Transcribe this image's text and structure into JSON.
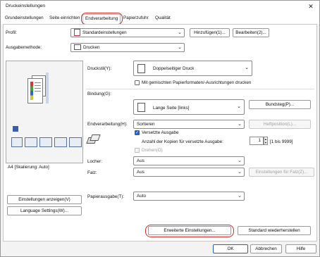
{
  "window": {
    "title": "Druckeinstellungen",
    "close_glyph": "✕"
  },
  "tabs": [
    {
      "label": "Grundeinstellungen"
    },
    {
      "label": "Seite einrichten"
    },
    {
      "label": "Endverarbeitung"
    },
    {
      "label": "Papierzufuhr"
    },
    {
      "label": "Qualität"
    }
  ],
  "profile": {
    "label": "Profil:",
    "value": "Standardeinstellungen",
    "add_button": "Hinzufügen(1)...",
    "edit_button": "Bearbeiten(2)..."
  },
  "output": {
    "label": "Ausgabemethode:",
    "value": "Drucken"
  },
  "preview": {
    "caption": "A4 [Skalierung: Auto]",
    "settings_button": "Einstellungen anzeigen(V)",
    "language_button": "Language Settings(W)..."
  },
  "print_style": {
    "label": "Druckstil(Y):",
    "value": "Doppelseitiger Druck",
    "mixed_checkbox": "Mit gemischten Papierformaten/-Ausrichtungen drucken",
    "mixed_checked": false
  },
  "binding": {
    "label": "Bindung(G):",
    "value": "Lange Seite [links]",
    "gutter_button": "Bundsteg(P)..."
  },
  "finishing": {
    "label": "Endverarbeitung(H):",
    "value": "Sortieren",
    "staple_button": "Heftposition(L)...",
    "offset_label": "Versetzte Ausgabe",
    "offset_checked": true,
    "copies_label": "Anzahl der Kopien für versetzte Ausgabe:",
    "copies_value": "1",
    "copies_range": "[1 bis 9999]",
    "rotate_label": "Drehen(O)",
    "rotate_checked": false
  },
  "punch": {
    "label": "Locher:",
    "value": "Aus"
  },
  "fold": {
    "label": "Falz:",
    "value": "Aus",
    "fold_button": "Einstellungen für Falz(Z)..."
  },
  "paper_output": {
    "label": "Papierausgabe(T):",
    "value": "Auto"
  },
  "bottom": {
    "advanced_button": "Erweiterte Einstellungen...",
    "restore_button": "Standard wiederherstellen",
    "ok": "OK",
    "cancel": "Abbrechen",
    "help": "Hilfe"
  },
  "colors": {
    "highlight_ring": "#d42a2a",
    "accent": "#1f63c8"
  }
}
